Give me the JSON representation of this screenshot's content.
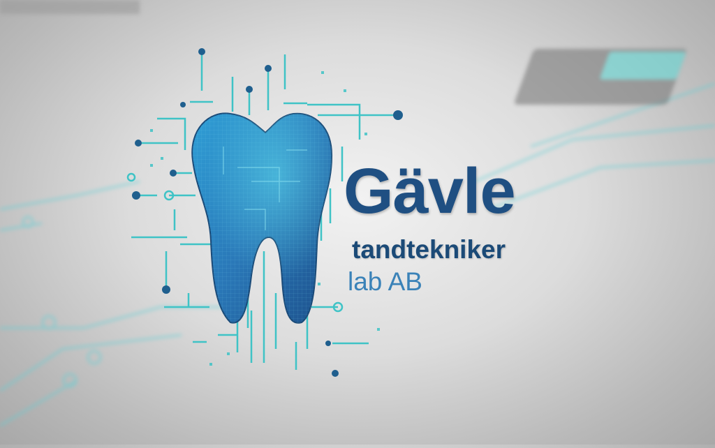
{
  "logo": {
    "name": "Gävle",
    "subtitle": "tandtekniker",
    "suffix": "lab AB",
    "icon": "tooth-circuit-icon"
  },
  "colors": {
    "primary": "#1f4f82",
    "accent": "#3a82b8",
    "circuit": "#3fc3c6",
    "background": "#d6d6d6"
  }
}
